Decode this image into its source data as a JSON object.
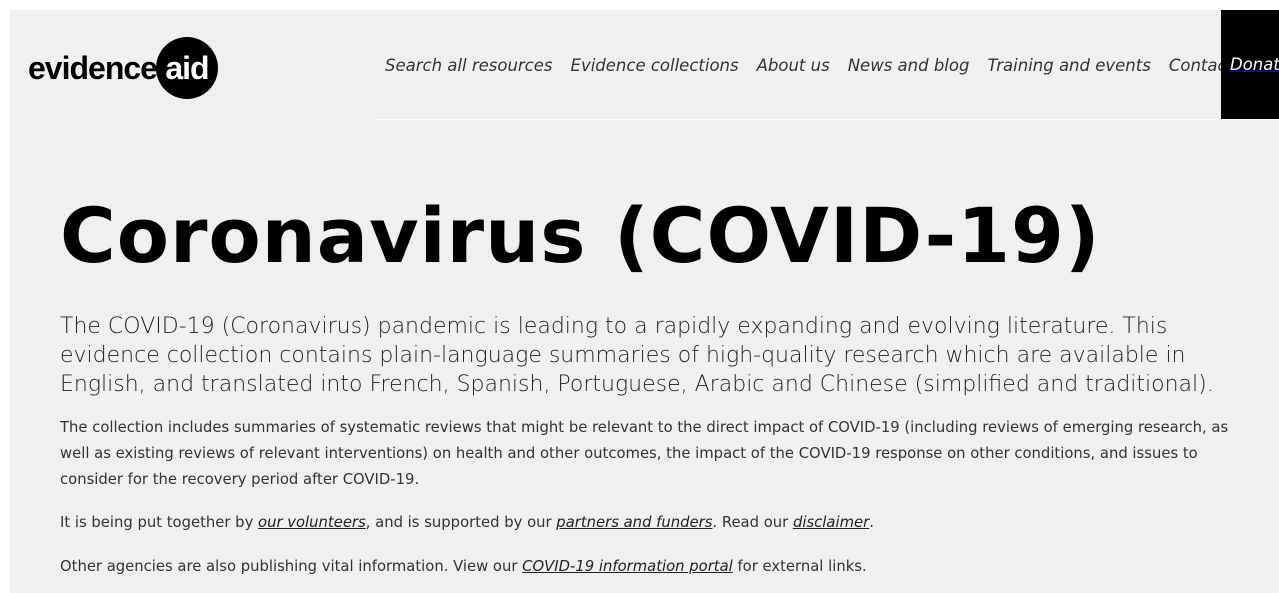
{
  "brand": {
    "logo_word": "evidence",
    "logo_circle_word": "aid"
  },
  "nav": {
    "items": [
      {
        "label": "Search all resources"
      },
      {
        "label": "Evidence collections"
      },
      {
        "label": "About us"
      },
      {
        "label": "News and blog"
      },
      {
        "label": "Training and events"
      },
      {
        "label": "Contact"
      }
    ],
    "donate_label": "Donat"
  },
  "main": {
    "title": "Coronavirus (COVID-19)",
    "lead": "The COVID-19 (Coronavirus) pandemic is leading to a rapidly expanding and evolving literature. This evidence collection contains plain-language summaries of high-quality research which are available in English, and translated into French, Spanish, Portuguese, Arabic and Chinese (simplified and traditional).",
    "paragraph1": "The collection includes summaries of systematic reviews that might be relevant to the direct impact of COVID-19 (including reviews of emerging research, as well as existing reviews of relevant interventions) on health and other outcomes, the impact of the COVID-19 response on other conditions, and issues to consider for the recovery period after COVID-19.",
    "paragraph2": {
      "part1": "It is being put together by ",
      "link1": "our volunteers",
      "part2": ", and is supported by our ",
      "link2": "partners and funders",
      "part3": ". Read our ",
      "link3": "disclaimer",
      "part4": "."
    },
    "paragraph3": {
      "part1": "Other agencies are also publishing vital information. View our ",
      "link1": "COVID-19 information portal",
      "part2": " for external links."
    }
  }
}
